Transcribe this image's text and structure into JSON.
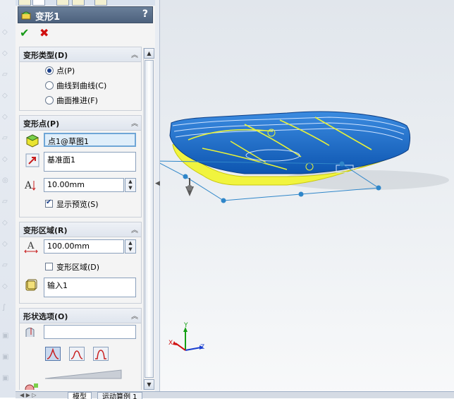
{
  "feature": {
    "title": "变形1",
    "help": "?"
  },
  "actions": {
    "ok": "✔",
    "cancel": "✖"
  },
  "groups": {
    "deform_type": {
      "title": "变形类型(D)",
      "options": [
        "点(P)",
        "曲线到曲线(C)",
        "曲面推进(F)"
      ],
      "selected": "点(P)"
    },
    "deform_point": {
      "title": "变形点(P)",
      "point_value": "点1@草图1",
      "direction_value": "基准面1",
      "distance_value": "10.00mm",
      "show_preview_label": "显示预览(S)",
      "show_preview": true
    },
    "deform_region": {
      "title": "变形区域(R)",
      "radius_value": "100.00mm",
      "region_label": "变形区域(D)",
      "region_checked": false,
      "body_value": "输入1"
    },
    "shape_options": {
      "title": "形状选项(O)",
      "rigidity_value": ""
    }
  },
  "bottom_tabs": [
    "模型",
    "运动算例 1"
  ],
  "triad": {
    "x": "X",
    "y": "Y",
    "z": "Z"
  },
  "colors": {
    "title_bar": "#55697f",
    "model_blue": "#1b6fd1",
    "model_yellow": "#eef23a",
    "handle": "#2f86c9"
  }
}
